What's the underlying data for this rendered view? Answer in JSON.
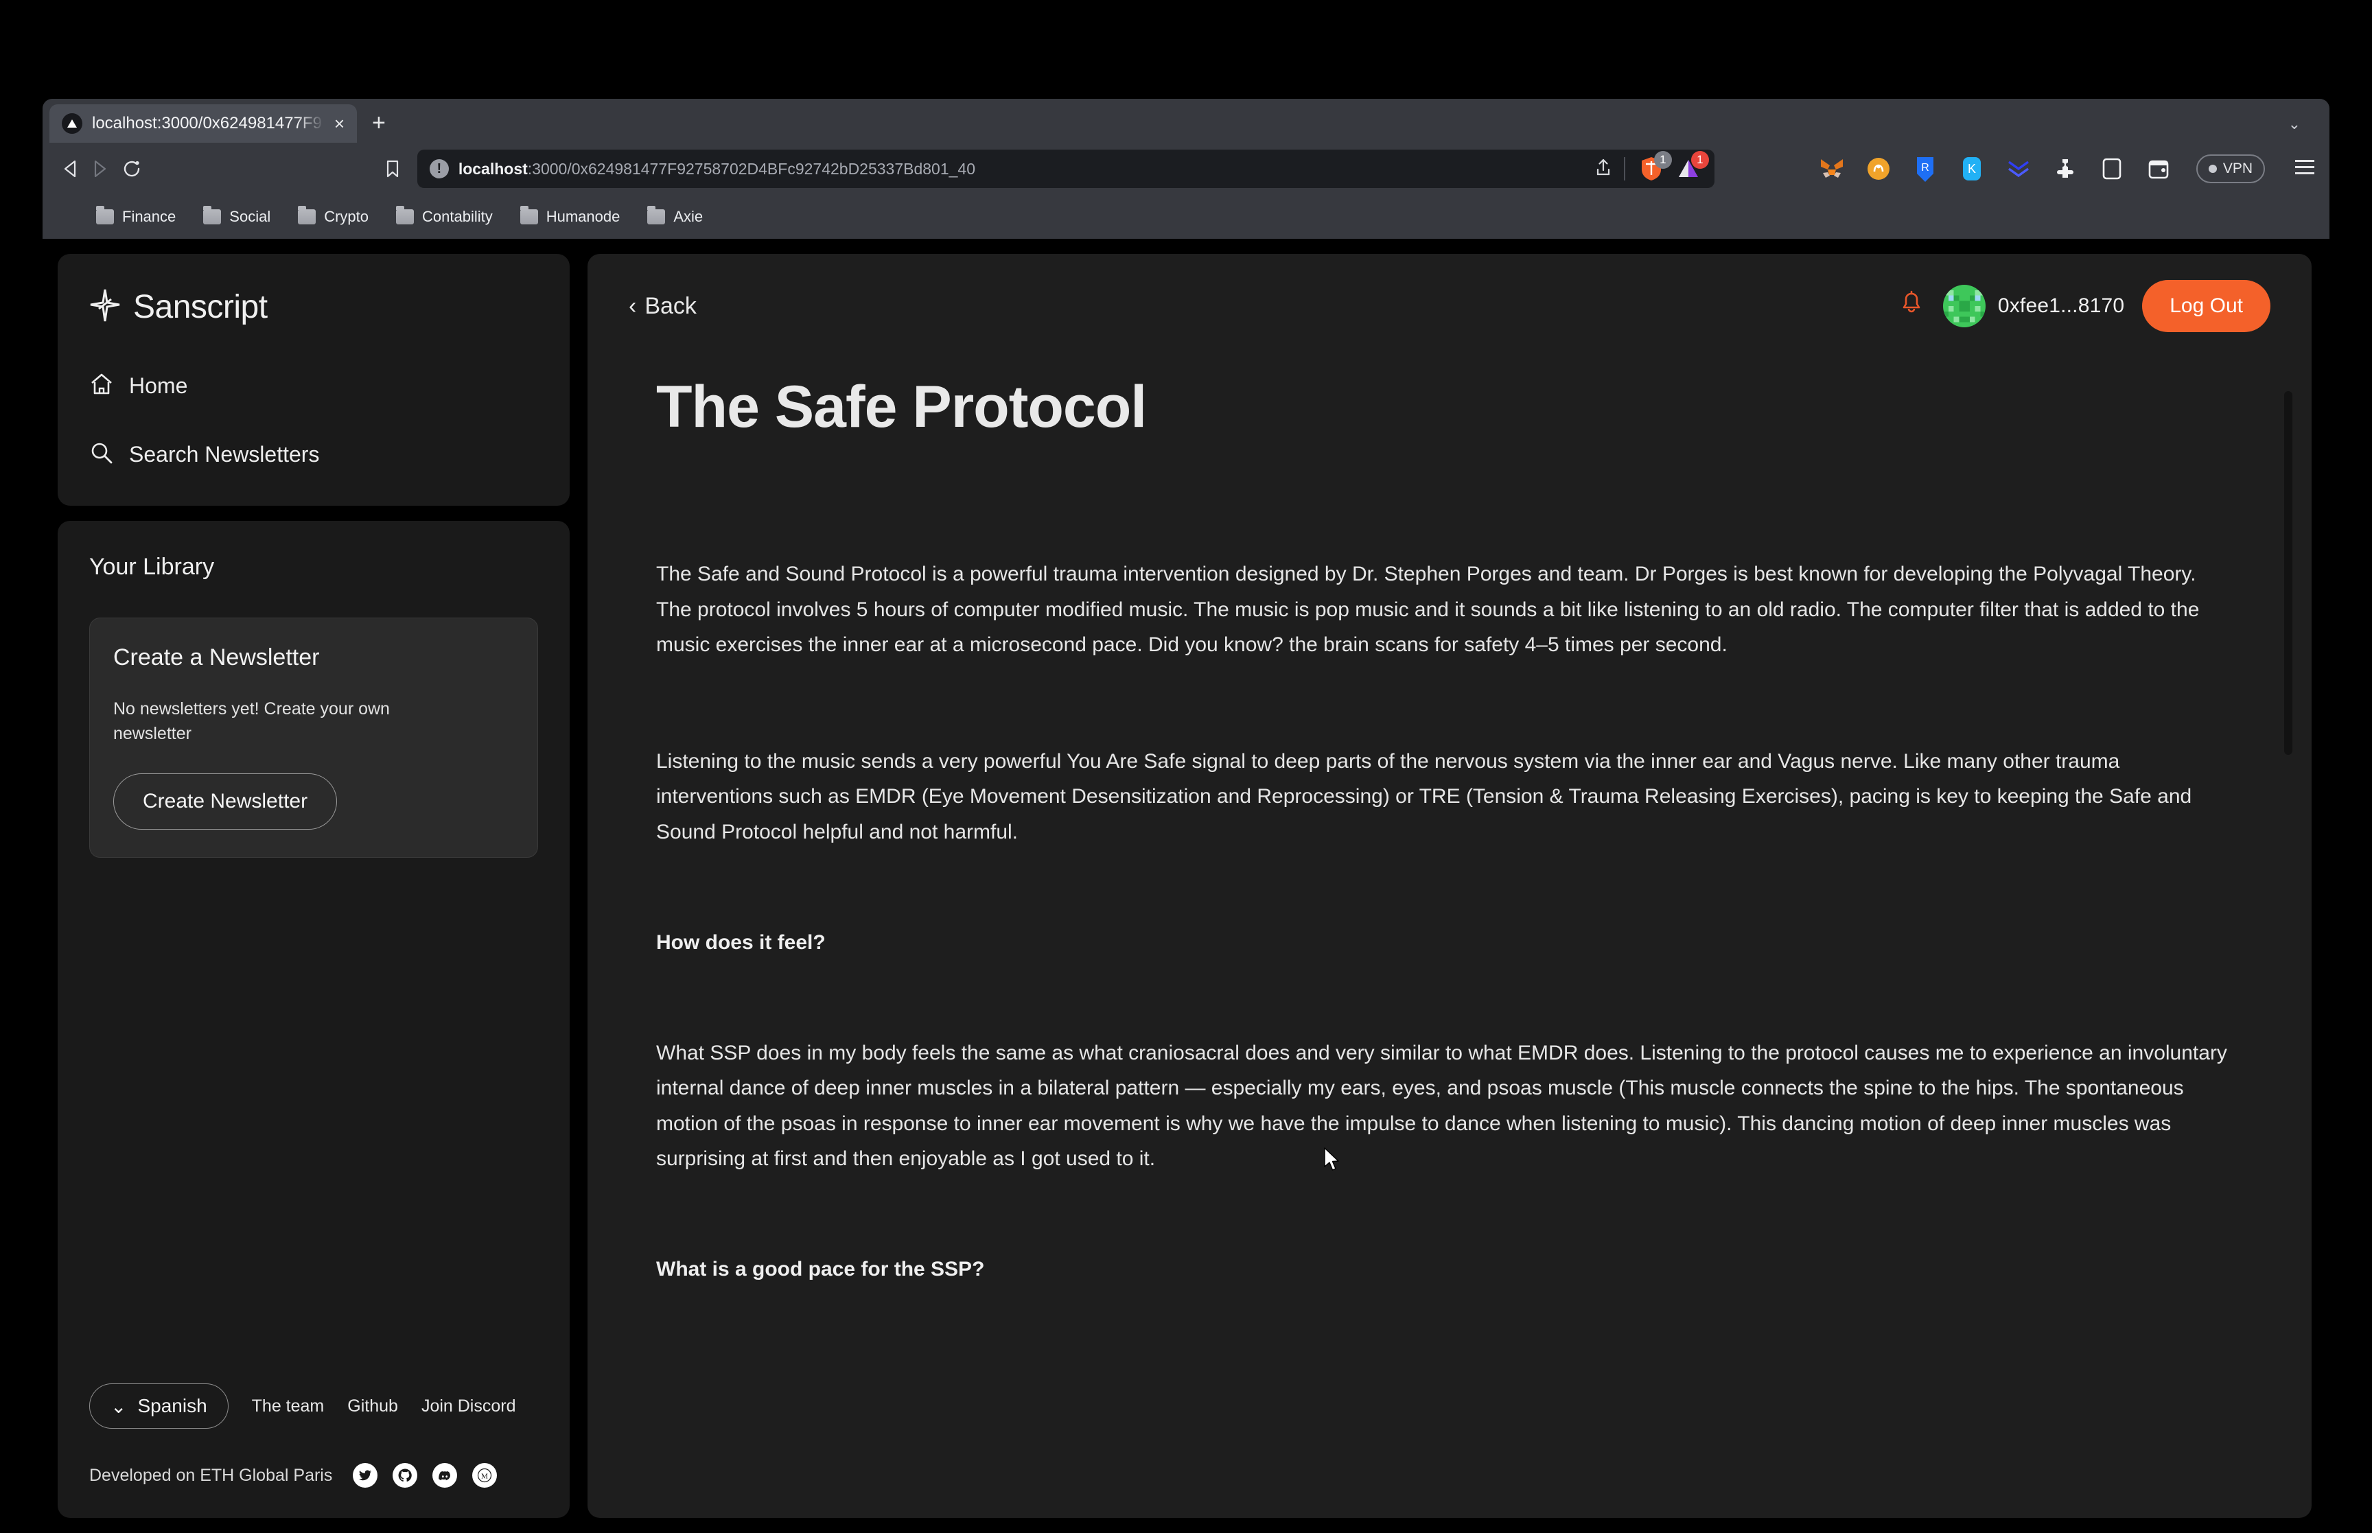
{
  "browser": {
    "tab": {
      "title": "localhost:3000/0x624981477F9",
      "favicon": "brave-triangle-icon",
      "close_label": "×"
    },
    "new_tab_label": "+",
    "tabstrip_chevron": "⌄",
    "nav": {
      "back": "‹",
      "forward": "›",
      "reload": "reload-icon",
      "bookmark": "bookmark-icon"
    },
    "url": {
      "host": "localhost",
      "path": ":3000/0x624981477F92758702D4BFc92742bD25337Bd801_40",
      "info_glyph": "!",
      "shield_count": "1",
      "notification_count": "1"
    },
    "extensions": [
      {
        "name": "metamask-icon"
      },
      {
        "name": "phantom-icon"
      },
      {
        "name": "rabby-icon"
      },
      {
        "name": "keplr-icon"
      },
      {
        "name": "vvs-icon"
      },
      {
        "name": "puzzle-extensions-icon"
      },
      {
        "name": "sidebar-panel-icon"
      },
      {
        "name": "wallet-icon"
      }
    ],
    "vpn_label": "VPN",
    "menu_glyph": "☰",
    "bookmarks": [
      {
        "label": "Finance"
      },
      {
        "label": "Social"
      },
      {
        "label": "Crypto"
      },
      {
        "label": "Contability"
      },
      {
        "label": "Humanode"
      },
      {
        "label": "Axie"
      }
    ]
  },
  "sidebar": {
    "brand": {
      "name": "Sanscript",
      "logo": "spark-logo-icon"
    },
    "nav_items": [
      {
        "label": "Home",
        "icon": "home-icon"
      },
      {
        "label": "Search Newsletters",
        "icon": "search-icon"
      }
    ],
    "library": {
      "title": "Your Library",
      "create_card": {
        "title": "Create a Newsletter",
        "subtitle": "No newsletters yet! Create your own newsletter",
        "button_label": "Create Newsletter"
      }
    },
    "footer": {
      "language": {
        "label": "Spanish",
        "chevron": "⌄"
      },
      "links": [
        {
          "label": "The team"
        },
        {
          "label": "Github"
        },
        {
          "label": "Join Discord"
        }
      ],
      "credit": "Developed on ETH Global Paris",
      "socials": [
        {
          "name": "twitter-icon"
        },
        {
          "name": "github-icon"
        },
        {
          "name": "discord-icon"
        },
        {
          "name": "medium-icon"
        }
      ]
    }
  },
  "main": {
    "back_label": "Back",
    "back_chevron": "‹",
    "bell_icon": "notification-bell-icon",
    "account": {
      "address": "0xfee1...8170",
      "avatar": "blockie-avatar"
    },
    "logout_label": "Log Out",
    "article": {
      "title": "The Safe Protocol",
      "blocks": [
        {
          "type": "paragraph",
          "text": "The Safe and Sound Protocol is a powerful trauma intervention designed by Dr. Stephen Porges and team. Dr Porges is best known for developing the Polyvagal Theory. The protocol involves 5 hours of computer modified music. The music is pop music and it sounds a bit like listening to an old radio. The computer filter that is added to the music exercises the inner ear at a microsecond pace. Did you know? the brain scans for safety 4–5 times per second."
        },
        {
          "type": "paragraph",
          "text": "Listening to the music sends a very powerful You Are Safe signal to deep parts of the nervous system via the inner ear and Vagus nerve. Like many other trauma interventions such as EMDR (Eye Movement Desensitization and Reprocessing) or TRE (Tension & Trauma Releasing Exercises), pacing is key to keeping the Safe and Sound Protocol helpful and not harmful."
        },
        {
          "type": "heading",
          "text": "How does it feel?"
        },
        {
          "type": "paragraph",
          "text": "What SSP does in my body feels the same as what craniosacral does and very similar to what EMDR does. Listening to the protocol causes me to experience an involuntary internal dance of deep inner muscles in a bilateral pattern — especially my ears, eyes, and psoas muscle (This muscle connects the spine to the hips. The spontaneous motion of the psoas in response to inner ear movement is why we have the impulse to dance when listening to music). This dancing motion of deep inner muscles was surprising at first and then enjoyable as I got used to it."
        },
        {
          "type": "heading",
          "text": "What is a good pace for the SSP?"
        }
      ]
    }
  },
  "colors": {
    "accent_orange": "#f4612a",
    "bell_orange": "#e8562a",
    "page_bg": "#000000",
    "panel_bg": "#1e1e1e",
    "sidebar_bg": "#1a1a1a"
  }
}
